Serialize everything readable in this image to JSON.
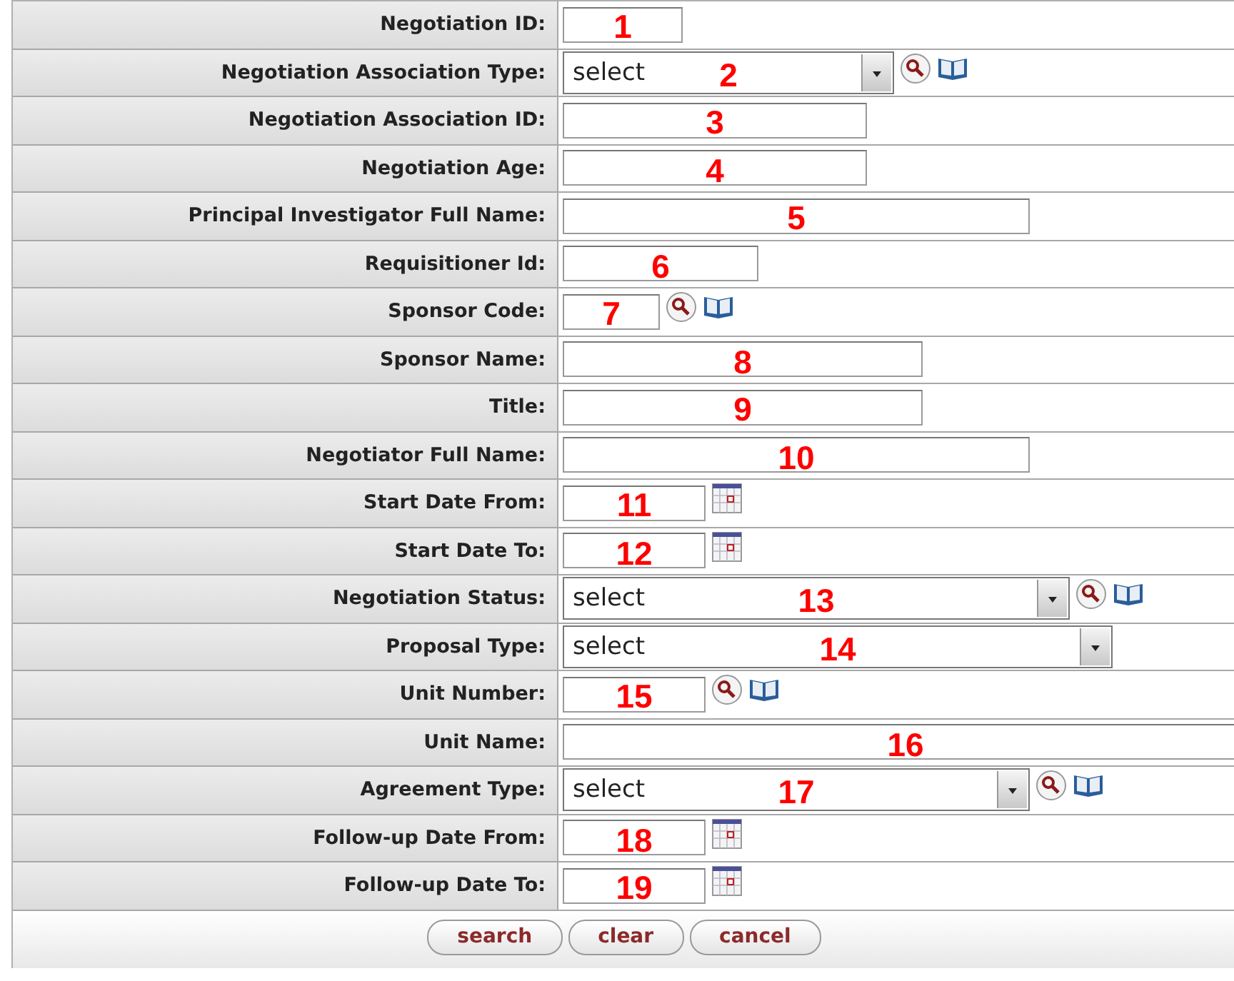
{
  "form": {
    "rows": [
      {
        "label": "Negotiation ID:",
        "kind": "text",
        "marker": "1",
        "lookup": false,
        "book": false,
        "calendar": false
      },
      {
        "label": "Negotiation Association Type:",
        "kind": "select",
        "value": "select",
        "marker": "2",
        "lookup": true,
        "book": true,
        "calendar": false
      },
      {
        "label": "Negotiation Association ID:",
        "kind": "text",
        "marker": "3",
        "lookup": false,
        "book": false,
        "calendar": false
      },
      {
        "label": "Negotiation Age:",
        "kind": "text",
        "marker": "4",
        "lookup": false,
        "book": false,
        "calendar": false
      },
      {
        "label": "Principal Investigator Full Name:",
        "kind": "text",
        "marker": "5",
        "lookup": false,
        "book": false,
        "calendar": false
      },
      {
        "label": "Requisitioner Id:",
        "kind": "text",
        "marker": "6",
        "lookup": false,
        "book": false,
        "calendar": false
      },
      {
        "label": "Sponsor Code:",
        "kind": "text",
        "marker": "7",
        "lookup": true,
        "book": true,
        "calendar": false
      },
      {
        "label": "Sponsor Name:",
        "kind": "text",
        "marker": "8",
        "lookup": false,
        "book": false,
        "calendar": false
      },
      {
        "label": "Title:",
        "kind": "text",
        "marker": "9",
        "lookup": false,
        "book": false,
        "calendar": false
      },
      {
        "label": "Negotiator Full Name:",
        "kind": "text",
        "marker": "10",
        "lookup": false,
        "book": false,
        "calendar": false
      },
      {
        "label": "Start Date From:",
        "kind": "text",
        "marker": "11",
        "lookup": false,
        "book": false,
        "calendar": true
      },
      {
        "label": "Start Date To:",
        "kind": "text",
        "marker": "12",
        "lookup": false,
        "book": false,
        "calendar": true
      },
      {
        "label": "Negotiation Status:",
        "kind": "select",
        "value": "select",
        "marker": "13",
        "lookup": true,
        "book": true,
        "calendar": false
      },
      {
        "label": "Proposal Type:",
        "kind": "select",
        "value": "select",
        "marker": "14",
        "lookup": false,
        "book": false,
        "calendar": false
      },
      {
        "label": "Unit Number:",
        "kind": "text",
        "marker": "15",
        "lookup": true,
        "book": true,
        "calendar": false
      },
      {
        "label": "Unit Name:",
        "kind": "text",
        "marker": "16",
        "lookup": false,
        "book": false,
        "calendar": false
      },
      {
        "label": "Agreement Type:",
        "kind": "select",
        "value": "select",
        "marker": "17",
        "lookup": true,
        "book": true,
        "calendar": false
      },
      {
        "label": "Follow-up Date From:",
        "kind": "text",
        "marker": "18",
        "lookup": false,
        "book": false,
        "calendar": true
      },
      {
        "label": "Follow-up Date To:",
        "kind": "text",
        "marker": "19",
        "lookup": false,
        "book": false,
        "calendar": true
      }
    ]
  },
  "buttons": [
    "search",
    "clear",
    "cancel"
  ]
}
